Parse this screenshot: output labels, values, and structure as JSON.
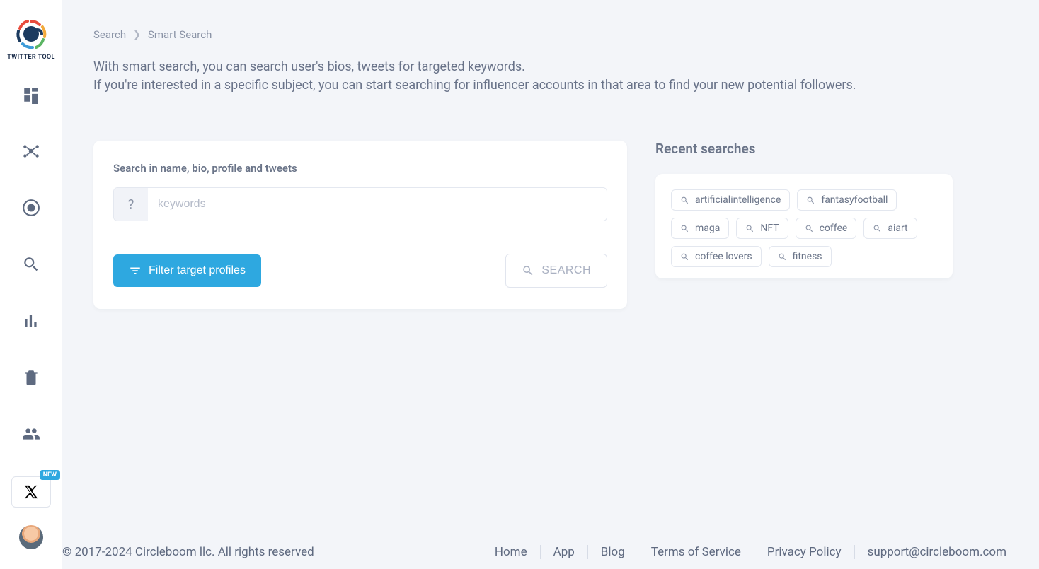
{
  "logo_text": "TWITTER TOOL",
  "badge_new": "NEW",
  "breadcrumb": {
    "root": "Search",
    "leaf": "Smart Search"
  },
  "desc_line1": "With smart search, you can search user's bios, tweets for targeted keywords.",
  "desc_line2": "If you're interested in a specific subject, you can start searching for influencer accounts in that area to find your new potential followers.",
  "search_card": {
    "label": "Search in name, bio, profile and tweets",
    "placeholder": "keywords",
    "filter_label": "Filter target profiles",
    "search_label": "SEARCH"
  },
  "recent": {
    "title": "Recent searches",
    "items": [
      "artificialintelligence",
      "fantasyfootball",
      "maga",
      "NFT",
      "coffee",
      "aiart",
      "coffee lovers",
      "fitness"
    ]
  },
  "footer": {
    "copyright": "© 2017-2024 Circleboom llc. All rights reserved",
    "links": [
      "Home",
      "App",
      "Blog",
      "Terms of Service",
      "Privacy Policy",
      "support@circleboom.com"
    ]
  }
}
